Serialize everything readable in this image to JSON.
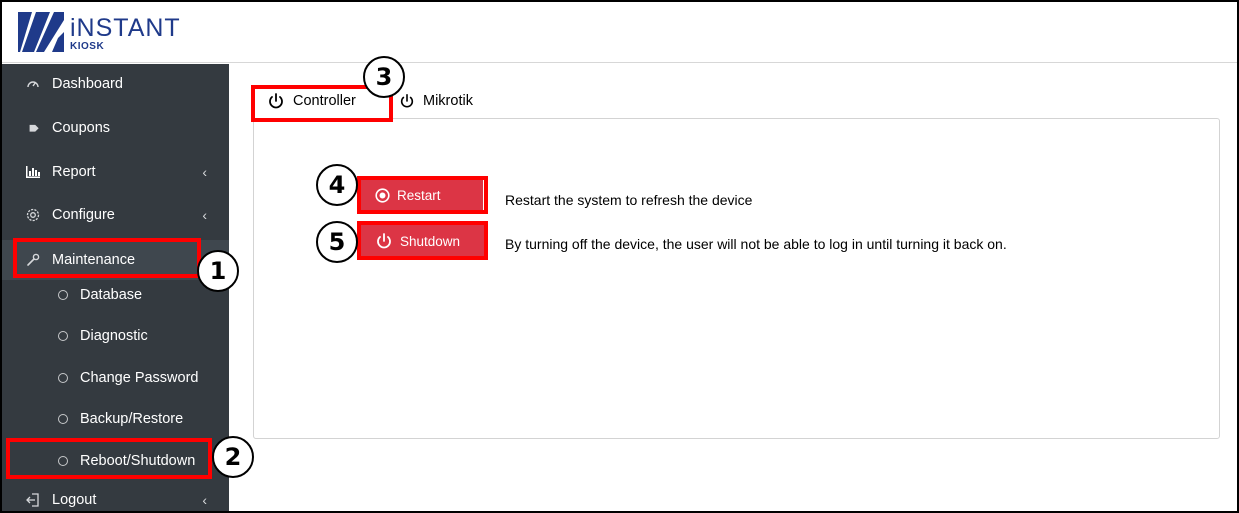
{
  "brand": {
    "name": "iNSTANT",
    "sub": "KIOSK",
    "color": "#1f3a8a"
  },
  "sidebar": {
    "items": [
      {
        "label": "Dashboard",
        "icon": "gauge-icon"
      },
      {
        "label": "Coupons",
        "icon": "tag-icon"
      },
      {
        "label": "Report",
        "icon": "bar-chart-icon",
        "chevron": "‹"
      },
      {
        "label": "Configure",
        "icon": "gear-icon",
        "chevron": "‹"
      },
      {
        "label": "Maintenance",
        "icon": "wrench-icon"
      }
    ],
    "subitems": [
      {
        "label": "Database"
      },
      {
        "label": "Diagnostic"
      },
      {
        "label": "Change Password"
      },
      {
        "label": "Backup/Restore"
      },
      {
        "label": "Reboot/Shutdown"
      }
    ],
    "logout": {
      "label": "Logout",
      "icon": "logout-icon",
      "chevron": "‹"
    }
  },
  "tabs": [
    {
      "label": "Controller",
      "icon": "power-icon"
    },
    {
      "label": "Mikrotik",
      "icon": "power-icon"
    }
  ],
  "actions": {
    "restart": {
      "label": "Restart",
      "description": "Restart the system to refresh the device",
      "icon": "record-icon"
    },
    "shutdown": {
      "label": "Shutdown",
      "description": "By turning off the device, the user will not be able to log in until turning it back on.",
      "icon": "power-icon"
    }
  },
  "annotations": [
    "1",
    "2",
    "3",
    "4",
    "5"
  ],
  "colors": {
    "sidebar": "#343a40",
    "danger": "#dc3545",
    "highlight": "#ff0000"
  }
}
